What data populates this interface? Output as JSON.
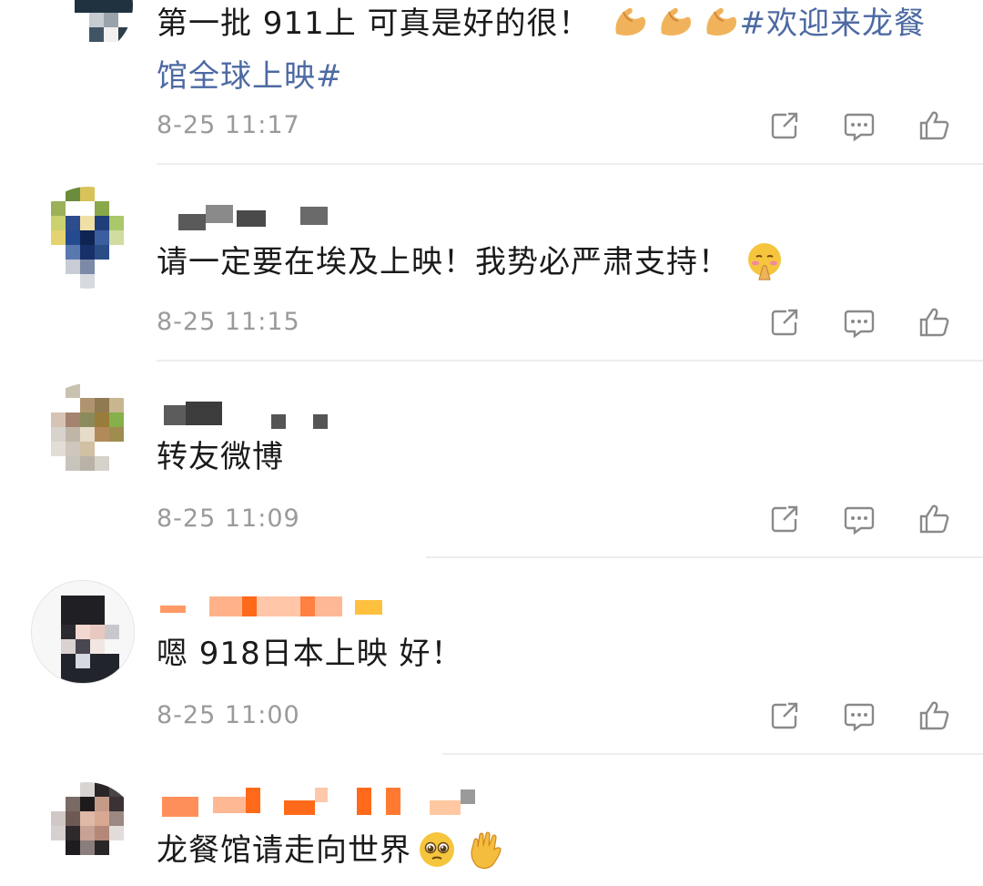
{
  "comments": [
    {
      "text_parts": [
        "第一批 911上 可真是好的很！",
        "#欢迎来龙餐",
        "馆全球上映#"
      ],
      "time": "8-25 11:17",
      "emojis": [
        "flexed-biceps",
        "flexed-biceps",
        "flexed-biceps"
      ]
    },
    {
      "text": "请一定要在埃及上映！我势必严肃支持！",
      "time": "8-25 11:15",
      "emojis": [
        "pleading-hands"
      ]
    },
    {
      "text": "转友微博",
      "time": "8-25 11:09",
      "emojis": []
    },
    {
      "text": "嗯 918日本上映 好！",
      "time": "8-25 11:00",
      "emojis": []
    },
    {
      "text": "龙餐馆请走向世界",
      "time": "",
      "emojis": [
        "pleading-face",
        "waving-hand"
      ]
    }
  ],
  "colors": {
    "hashtag": "#4d6aa3",
    "timestamp": "#9a9a9a",
    "divider": "#ededed",
    "icon": "#8a8a8a",
    "username_blur_orange": "#ff6a1a"
  },
  "action_icons": [
    "repost-icon",
    "comment-icon",
    "like-icon"
  ]
}
